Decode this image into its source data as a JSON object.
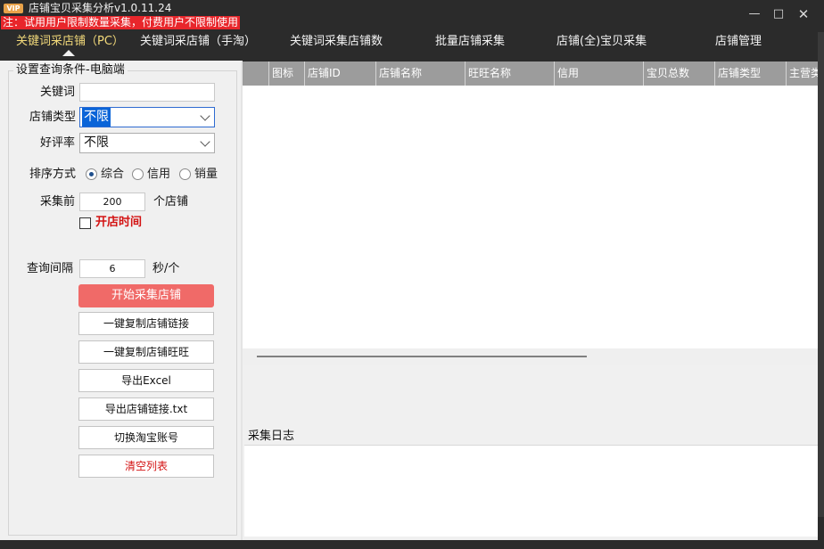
{
  "window": {
    "badge": "VIP",
    "title": "店铺宝贝采集分析v1.0.11.24",
    "notice": "注：试用用户限制数量采集，付费用户不限制使用",
    "minimize": "—",
    "maximize": "□",
    "close": "✕"
  },
  "tabs": [
    {
      "label": "关键词采店铺（PC）",
      "active": true
    },
    {
      "label": "关键词采店铺（手淘）"
    },
    {
      "label": "关键词采集店铺数"
    },
    {
      "label": "批量店铺采集"
    },
    {
      "label": "店铺(全)宝贝采集"
    },
    {
      "label": "店铺管理"
    }
  ],
  "settings": {
    "group_title": "设置查询条件-电脑端",
    "keyword_label": "关键词",
    "keyword_value": "",
    "shop_type_label": "店铺类型",
    "shop_type_value": "不限",
    "rating_label": "好评率",
    "rating_value": "不限",
    "sort_label": "排序方式",
    "sort_options": [
      "综合",
      "信用",
      "销量"
    ],
    "sort_selected": "综合",
    "collect_label": "采集前",
    "collect_value": "200",
    "collect_unit": "个店铺",
    "open_time_label": "开店时间",
    "open_time_checked": false,
    "interval_label": "查询间隔",
    "interval_value": "6",
    "interval_unit": "秒/个"
  },
  "actions": {
    "start": "开始采集店铺",
    "copy_links": "一键复制店铺链接",
    "copy_wangwang": "一键复制店铺旺旺",
    "export_excel": "导出Excel",
    "export_txt": "导出店铺链接.txt",
    "switch_account": "切换淘宝账号",
    "clear_list": "清空列表"
  },
  "grid": {
    "columns": [
      "",
      "图标",
      "店铺ID",
      "店铺名称",
      "旺旺名称",
      "信用",
      "宝贝总数",
      "店铺类型",
      "主营类"
    ],
    "rows": []
  },
  "log": {
    "title": "采集日志",
    "content": ""
  },
  "colors": {
    "primary_button": "#f06a68",
    "danger_text": "#d31313",
    "active_tab": "#f2d97a",
    "header_bg": "#9c9c9c"
  }
}
